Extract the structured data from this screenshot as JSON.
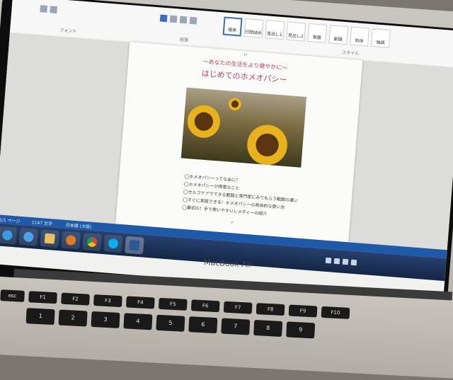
{
  "ribbon": {
    "font_group_label": "フォント",
    "paragraph_group_label": "段落",
    "styles_group_label": "スタイル",
    "styles": [
      "標準",
      "行間詰め",
      "見出し1",
      "見出し2",
      "表題",
      "副題",
      "斜体",
      "強調"
    ]
  },
  "document": {
    "subtitle": "～あなたの生活をより健やかに～",
    "title": "はじめてのホメオパシー",
    "bullets": [
      "◯ホメオパシーってなあに？",
      "◯ホメオパシーが得意なこと",
      "◯セルフケアでできる範囲と専門家にみてもらう範囲の違い",
      "◯すぐに実践できる！ホメオパシーの具体的な使い方",
      "◯最初の！手で使いやすいレメディーの紹介"
    ]
  },
  "statusbar": {
    "page": "1/1 ページ",
    "words": "1147 文字",
    "language": "日本語 (大阪)"
  },
  "device": {
    "brand": "MacBook Air"
  },
  "keyboard": {
    "fn_row": [
      "esc",
      "F1",
      "F2",
      "F3",
      "F4",
      "F5",
      "F6",
      "F7",
      "F8",
      "F9",
      "F10"
    ],
    "number_row": [
      "1",
      "2",
      "3",
      "4",
      "5",
      "6",
      "7",
      "8",
      "9"
    ]
  },
  "colors": {
    "accent_title": "#c23c6a",
    "taskbar": "#1e5aa8"
  }
}
